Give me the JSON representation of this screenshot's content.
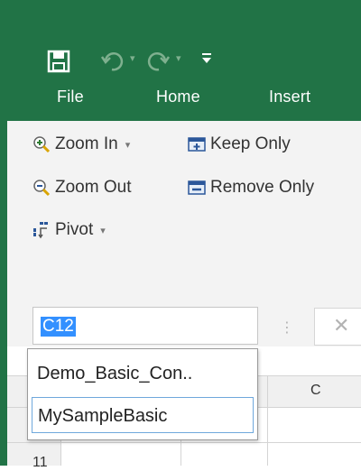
{
  "colors": {
    "accent": "#217346",
    "ribbon_bg": "#f3f3f3",
    "selection": "#3390ff"
  },
  "qat": {
    "icons": [
      "save-icon",
      "undo-icon",
      "redo-icon",
      "customize-qat-icon"
    ]
  },
  "tabs": [
    {
      "label": "File"
    },
    {
      "label": "Home"
    },
    {
      "label": "Insert"
    }
  ],
  "ribbon": {
    "zoom_in": "Zoom In",
    "keep_only": "Keep Only",
    "zoom_out": "Zoom Out",
    "remove_only": "Remove Only",
    "pivot": "Pivot"
  },
  "namebox": {
    "value": "C12"
  },
  "formula_bar": {
    "separator": "⋮",
    "cancel": "✕"
  },
  "name_dropdown": {
    "items": [
      "Demo_Basic_Con..",
      "MySampleBasic"
    ],
    "highlighted_index": 1
  },
  "grid": {
    "visible_columns": [
      "C"
    ],
    "visible_rows": [
      "11"
    ]
  }
}
